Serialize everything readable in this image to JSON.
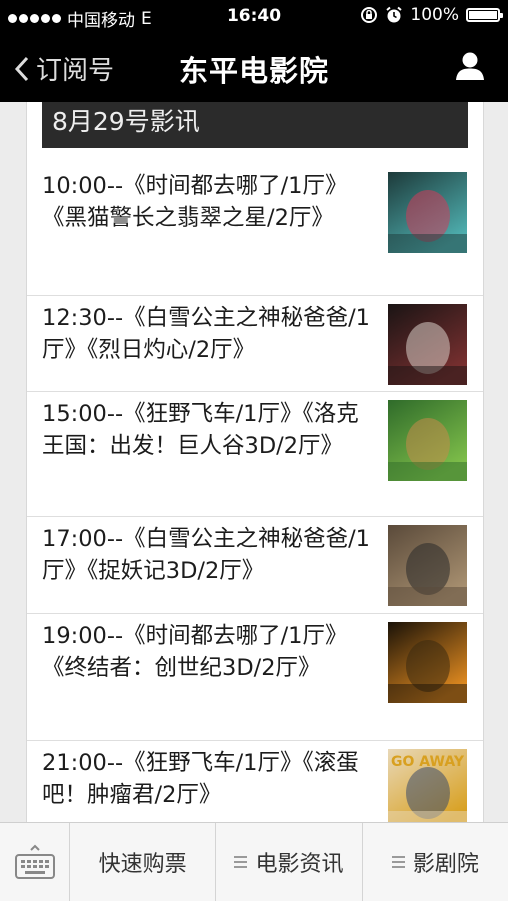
{
  "status_bar": {
    "carrier": "中国移动",
    "network": "E",
    "time": "16:40",
    "battery_text": "100%",
    "battery_level": 1.0
  },
  "nav": {
    "back_label": "订阅号",
    "title": "东平电影院"
  },
  "content": {
    "date_header": "8月29号影讯",
    "sessions": [
      {
        "schedule": "10:00--《时间都去哪了/1厅》《黑猫警长之翡翠之星/2厅》",
        "poster_colors": [
          "#1d3a3a",
          "#4fb0b0",
          "#d23a5a"
        ]
      },
      {
        "schedule": "12:30--《白雪公主之神秘爸爸/1厅》《烈日灼心/2厅》",
        "poster_colors": [
          "#1a1414",
          "#7a3030",
          "#d9d0c8"
        ]
      },
      {
        "schedule": "15:00--《狂野飞车/1厅》《洛克王国：出发！巨人谷3D/2厅》",
        "poster_colors": [
          "#2f6b2a",
          "#7fbf4a",
          "#c78b4a"
        ]
      },
      {
        "schedule": "17:00--《白雪公主之神秘爸爸/1厅》《捉妖记3D/2厅》",
        "poster_colors": [
          "#5a4a3a",
          "#a89070",
          "#2a2a2a"
        ]
      },
      {
        "schedule": "19:00--《时间都去哪了/1厅》《终结者：创世纪3D/2厅》",
        "poster_colors": [
          "#1a1208",
          "#e08a20",
          "#3a2a10"
        ]
      },
      {
        "schedule": "21:00--《狂野飞车/1厅》《滚蛋吧！肿瘤君/2厅》",
        "poster_colors": [
          "#e8d8b8",
          "#d8a020",
          "#3a4a6a"
        ],
        "poster_text": "GO AWAY"
      }
    ]
  },
  "bottom_bar": {
    "buttons": [
      "快速购票",
      "电影资讯",
      "影剧院"
    ]
  }
}
